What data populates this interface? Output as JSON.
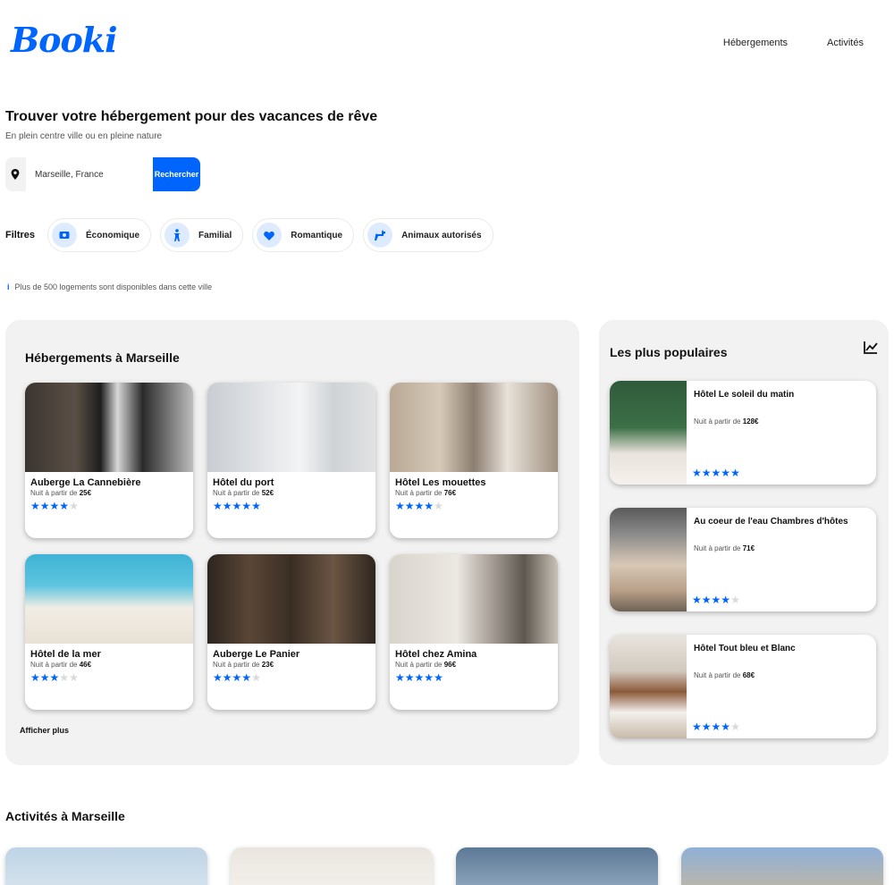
{
  "header": {
    "logo": "Booki",
    "nav": [
      "Hébergements",
      "Activités"
    ]
  },
  "hero": {
    "title": "Trouver votre hébergement pour des vacances de rêve",
    "subtitle": "En plein centre ville ou en pleine nature"
  },
  "search": {
    "value": "Marseille, France",
    "button": "Rechercher"
  },
  "filters": {
    "label": "Filtres",
    "items": [
      {
        "label": "Économique",
        "icon": "money-icon"
      },
      {
        "label": "Familial",
        "icon": "child-icon"
      },
      {
        "label": "Romantique",
        "icon": "heart-icon"
      },
      {
        "label": "Animaux autorisés",
        "icon": "dog-icon"
      }
    ]
  },
  "info": "Plus de 500 logements sont disponibles dans cette ville",
  "lodgings": {
    "title": "Hébergements à Marseille",
    "price_prefix": "Nuit à partir de",
    "more": "Afficher plus",
    "items": [
      {
        "name": "Auberge La Cannebière",
        "price": "25€",
        "rating": 4
      },
      {
        "name": "Hôtel du port",
        "price": "52€",
        "rating": 5
      },
      {
        "name": "Hôtel Les mouettes",
        "price": "76€",
        "rating": 4
      },
      {
        "name": "Hôtel de la mer",
        "price": "46€",
        "rating": 3
      },
      {
        "name": "Auberge Le Panier",
        "price": "23€",
        "rating": 4
      },
      {
        "name": "Hôtel chez Amina",
        "price": "96€",
        "rating": 5
      }
    ]
  },
  "popular": {
    "title": "Les plus populaires",
    "price_prefix": "Nuit à partir de",
    "items": [
      {
        "name": "Hôtel Le soleil du matin",
        "price": "128€",
        "rating": 5
      },
      {
        "name": "Au coeur de l'eau Chambres d'hôtes",
        "price": "71€",
        "rating": 4
      },
      {
        "name": "Hôtel Tout bleu et Blanc",
        "price": "68€",
        "rating": 4
      }
    ]
  },
  "activities": {
    "title": "Activités à Marseille"
  },
  "colors": {
    "accent": "#0065FC",
    "panel_bg": "#F2F2F2",
    "chip_icon_bg": "#DEEBFF"
  }
}
